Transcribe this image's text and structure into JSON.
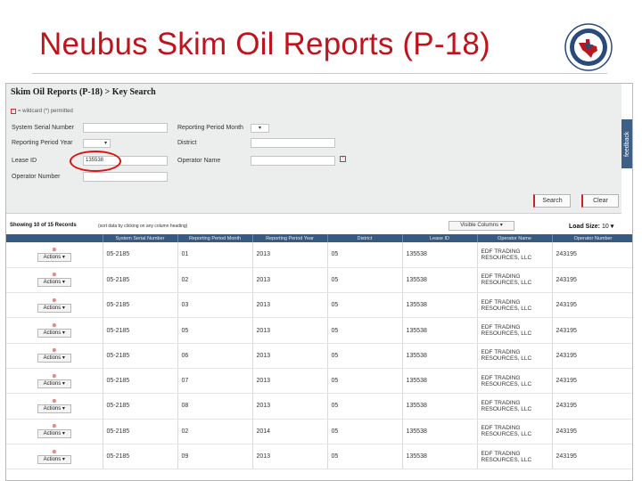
{
  "slide": {
    "title": "Neubus Skim Oil Reports (P-18)"
  },
  "search": {
    "panel_title": "Skim Oil Reports (P-18) > Key Search",
    "wildcard_note": "= wildcard (*) permitted",
    "fields": {
      "system_serial_number": {
        "label": "System Serial Number",
        "value": ""
      },
      "reporting_period_month": {
        "label": "Reporting Period Month",
        "value": ""
      },
      "reporting_period_year": {
        "label": "Reporting Period Year",
        "value": ""
      },
      "district": {
        "label": "District",
        "value": ""
      },
      "lease_id": {
        "label": "Lease ID",
        "value": "135538"
      },
      "operator_name": {
        "label": "Operator Name",
        "value": ""
      },
      "operator_number": {
        "label": "Operator Number",
        "value": ""
      }
    },
    "search_button": "Search",
    "clear_button": "Clear",
    "feedback_tab": "feedback"
  },
  "results": {
    "showing_text": "Showing 10 of 15 Records",
    "sort_hint": "(sort data by clicking on any column heading)",
    "visible_columns_label": "Visible Columns",
    "load_size_label": "Load Size:",
    "load_size_value": "10",
    "columns": [
      "",
      "System Serial Number",
      "Reporting Period Month",
      "Reporting Period Year",
      "District",
      "Lease ID",
      "Operator Name",
      "Operator Number"
    ],
    "actions_label": "Actions",
    "rows": [
      {
        "serial": "05-2185",
        "month": "01",
        "year": "2013",
        "district": "05",
        "lease": "135538",
        "op1": "EDF TRADING",
        "op2": "RESOURCES, LLC",
        "opnum": "243195"
      },
      {
        "serial": "05-2185",
        "month": "02",
        "year": "2013",
        "district": "05",
        "lease": "135538",
        "op1": "EDF TRADING",
        "op2": "RESOURCES, LLC",
        "opnum": "243195"
      },
      {
        "serial": "05-2185",
        "month": "03",
        "year": "2013",
        "district": "05",
        "lease": "135538",
        "op1": "EDF TRADING",
        "op2": "RESOURCES, LLC",
        "opnum": "243195"
      },
      {
        "serial": "05-2185",
        "month": "05",
        "year": "2013",
        "district": "05",
        "lease": "135538",
        "op1": "EDF TRADING",
        "op2": "RESOURCES, LLC",
        "opnum": "243195"
      },
      {
        "serial": "05-2185",
        "month": "06",
        "year": "2013",
        "district": "05",
        "lease": "135538",
        "op1": "EDF TRADING",
        "op2": "RESOURCES, LLC",
        "opnum": "243195"
      },
      {
        "serial": "05-2185",
        "month": "07",
        "year": "2013",
        "district": "05",
        "lease": "135538",
        "op1": "EDF TRADING",
        "op2": "RESOURCES, LLC",
        "opnum": "243195"
      },
      {
        "serial": "05-2185",
        "month": "08",
        "year": "2013",
        "district": "05",
        "lease": "135538",
        "op1": "EDF TRADING",
        "op2": "RESOURCES, LLC",
        "opnum": "243195"
      },
      {
        "serial": "05-2185",
        "month": "02",
        "year": "2014",
        "district": "05",
        "lease": "135538",
        "op1": "EDF TRADING",
        "op2": "RESOURCES, LLC",
        "opnum": "243195"
      },
      {
        "serial": "05-2185",
        "month": "09",
        "year": "2013",
        "district": "05",
        "lease": "135538",
        "op1": "EDF TRADING",
        "op2": "RESOURCES, LLC",
        "opnum": "243195"
      }
    ]
  },
  "colors": {
    "title": "#c0141c",
    "header": "#375a82",
    "feedback": "#3e5f86",
    "highlight": "#d11111"
  },
  "icons": {
    "seal": "texas-seal-icon",
    "delete": "delete-icon",
    "dropdown": "chevron-down-icon"
  }
}
